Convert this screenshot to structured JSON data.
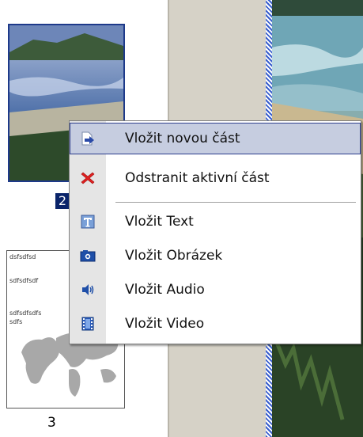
{
  "thumbnails": [
    {
      "page_number": "2",
      "selected": true
    },
    {
      "page_number": "3",
      "selected": false,
      "texts": [
        "dsfsdfsd",
        "sdfsdfsdf",
        "sdfsdfsdfs",
        "sdfs"
      ]
    }
  ],
  "context_menu": {
    "items": [
      {
        "label": "Vložit novou část",
        "icon": "insert-part-icon",
        "active": true
      },
      {
        "label": "Odstranit aktivní část",
        "icon": "delete-x-icon",
        "active": false
      },
      {
        "label": "Vložit Text",
        "icon": "text-icon",
        "active": false
      },
      {
        "label": "Vložit Obrázek",
        "icon": "image-icon",
        "active": false
      },
      {
        "label": "Vložit Audio",
        "icon": "audio-icon",
        "active": false
      },
      {
        "label": "Vložit Video",
        "icon": "video-icon",
        "active": false
      }
    ]
  },
  "colors": {
    "selection_border": "#2b3c8c",
    "selection_fill": "#c6cde0",
    "icon_strip": "#e5e5e5",
    "delete_red": "#e02020"
  }
}
